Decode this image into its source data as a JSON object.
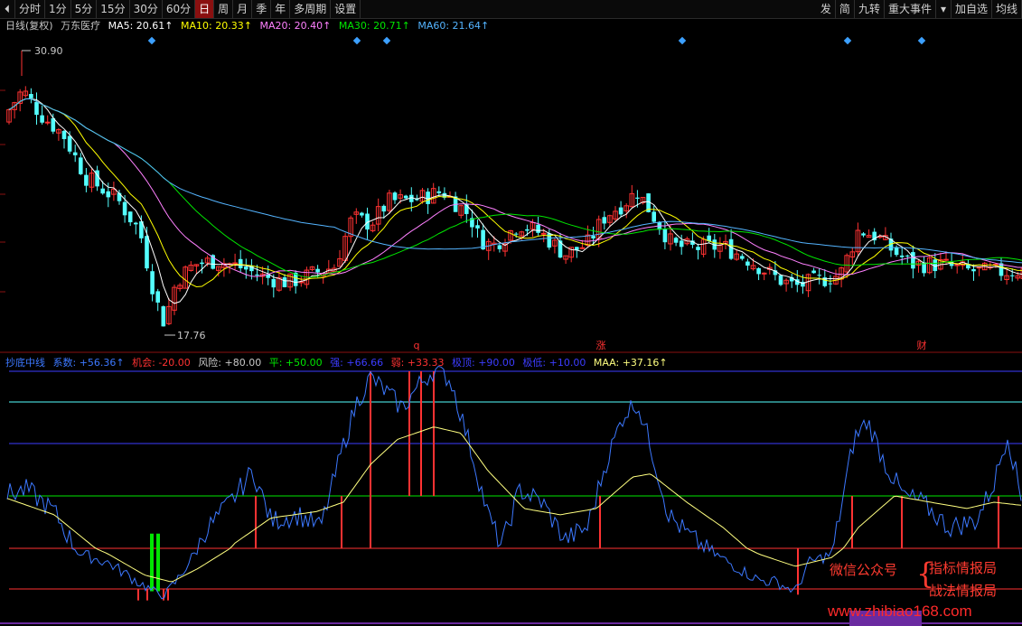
{
  "toolbar": {
    "left_arrow_icon": "back-arrow-icon",
    "periods": [
      "分时",
      "1分",
      "5分",
      "15分",
      "30分",
      "60分",
      "日",
      "周",
      "月",
      "季",
      "年",
      "多周期",
      "设置"
    ],
    "active_period": "日",
    "right_items": [
      "发",
      "简",
      "九转",
      "重大事件",
      "加自选",
      "均线"
    ],
    "dropdown_icon": "triangle-down-icon"
  },
  "price_info": {
    "period_label": "日线(复权)",
    "stock_name": "万东医疗",
    "ma5": "MA5: 20.61↑",
    "ma10": "MA10: 20.33↑",
    "ma20": "MA20: 20.40↑",
    "ma30": "MA30: 20.71↑",
    "ma60": "MA60: 21.64↑"
  },
  "price_annotations": {
    "high": "30.90",
    "low": "17.76",
    "markers": [
      "q",
      "涨",
      "财"
    ]
  },
  "indicator_info": {
    "name": "抄底中线",
    "coef": "系数: +56.36↑",
    "chance": "机会: -20.00",
    "risk": "风险: +80.00",
    "flat": "平: +50.00",
    "strong": "强: +66.66",
    "weak": "弱: +33.33",
    "top": "极顶: +90.00",
    "bottom": "极低: +10.00",
    "maa": "MAA: +37.16↑"
  },
  "watermark": {
    "wechat": "微信公众号",
    "brace": "{",
    "name1": "指标情报局",
    "name2": "战法情报局",
    "url": "www.zhibiao168.com"
  },
  "colors": {
    "up": "#ff3232",
    "down": "#54ffff",
    "ma5": "#ffffff",
    "ma10": "#ffff00",
    "ma20": "#ff80ff",
    "ma30": "#00e600",
    "ma60": "#54b4ff",
    "coef": "#3c78ff",
    "maa": "#ffff80"
  },
  "chart_data": {
    "type": "candlestick",
    "price_range": [
      17.76,
      30.9
    ],
    "indicator_levels": {
      "risk": 80.0,
      "flat": 50.0,
      "strong": 66.66,
      "weak": 33.33,
      "top": 90.0,
      "bottom": 10.0,
      "chance": -20.0
    },
    "indicator_last": {
      "coef": 56.36,
      "maa": 37.16
    }
  }
}
